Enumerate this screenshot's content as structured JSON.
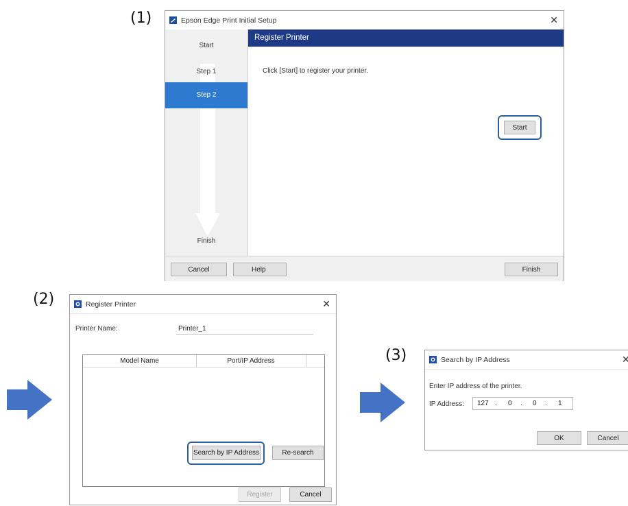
{
  "labels": {
    "one": "(1)",
    "two": "(2)",
    "three": "(3)"
  },
  "setup_window": {
    "title": "Epson Edge Print Initial Setup",
    "steps": [
      "Start",
      "Step 1",
      "Step 2",
      "Finish"
    ],
    "active_step": "Step 2",
    "panel_title": "Register Printer",
    "instruction": "Click [Start] to register your printer.",
    "start_button": "Start",
    "cancel_button": "Cancel",
    "help_button": "Help",
    "finish_button": "Finish"
  },
  "register_dialog": {
    "title": "Register Printer",
    "printer_name_label": "Printer Name:",
    "printer_name_value": "Printer_1",
    "columns": [
      "Model Name",
      "Port/IP Address"
    ],
    "search_ip_button": "Search by IP Address",
    "research_button": "Re-search",
    "register_button": "Register",
    "cancel_button": "Cancel"
  },
  "ip_dialog": {
    "title": "Search by IP Address",
    "prompt": "Enter IP address of the printer.",
    "ip_label": "IP Address:",
    "ip_octets": [
      "127",
      "0",
      "0",
      "1"
    ],
    "ok_button": "OK",
    "cancel_button": "Cancel"
  },
  "colors": {
    "accent": "#2e7ad1",
    "header": "#1e3a86",
    "arrow": "#4472c4",
    "highlight": "#2d5f9a"
  },
  "icons": {
    "arrow": "right-arrow-icon",
    "close": "close-icon",
    "app": "epson-app-icon"
  }
}
